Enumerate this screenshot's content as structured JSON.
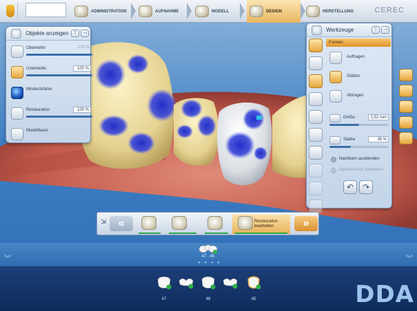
{
  "app": {
    "name": "CEREC",
    "brand": "DDA"
  },
  "workflow_steps": [
    {
      "label": "ADMINISTRATION",
      "active": false,
      "icon": "administration-icon"
    },
    {
      "label": "AUFNAHME",
      "active": false,
      "icon": "acquisition-icon"
    },
    {
      "label": "MODELL",
      "active": false,
      "icon": "model-icon"
    },
    {
      "label": "DESIGN",
      "active": true,
      "icon": "design-icon"
    },
    {
      "label": "HERSTELLUNG",
      "active": false,
      "icon": "manufacturing-icon"
    }
  ],
  "objekte_panel": {
    "title": "Objekte anzeigen",
    "btn_pin": "⊤",
    "btn_collapse": "⊣",
    "rows": [
      {
        "label": "Oberkiefer",
        "value": "100 %",
        "enabled": false,
        "level": 1.0
      },
      {
        "label": "Unterkiefer",
        "value": "100 %",
        "enabled": true,
        "level": 1.0
      },
      {
        "label": "Mindeststärke",
        "value": "",
        "enabled": true
      },
      {
        "label": "Restauration",
        "value": "100 %",
        "enabled": true,
        "level": 1.0
      },
      {
        "label": "Modellbasis",
        "value": "",
        "enabled": true
      }
    ]
  },
  "werkzeuge_panel": {
    "title": "Werkzeuge",
    "btn_pin": "⊤",
    "btn_collapse": "⊣",
    "section": "Formen",
    "tools": [
      {
        "label": "Auftragen",
        "active": false
      },
      {
        "label": "Glätten",
        "active": true
      },
      {
        "label": "Abtragen",
        "active": false
      }
    ],
    "params": [
      {
        "label": "Größe",
        "value": "2,52 mm",
        "level": 0.5
      },
      {
        "label": "Stärke",
        "value": "36 %",
        "level": 0.36
      }
    ],
    "checkboxes": [
      {
        "label": "Nachbarn ausblenden",
        "enabled": true
      },
      {
        "label": "Symmetrisch anwenden",
        "enabled": false
      }
    ],
    "undo": "↶",
    "redo": "↷"
  },
  "phases": {
    "pin": "⇲",
    "prev": "«",
    "next": "»",
    "items": [
      {
        "label": "",
        "active": false
      },
      {
        "label": "",
        "active": false
      },
      {
        "label": "",
        "active": false
      },
      {
        "label": "Restauration bearbeiten",
        "active": true
      }
    ]
  },
  "arch": {
    "label": "47 - 45",
    "pager": "● ● ● ●"
  },
  "carets": {
    "left": "︾",
    "right": "︾"
  },
  "teeth": [
    {
      "number": "47"
    },
    {
      "number": ""
    },
    {
      "number": "46"
    },
    {
      "number": ""
    },
    {
      "number": "45"
    }
  ],
  "colors": {
    "accent": "#e8a43c",
    "panel": "#d3e0ef",
    "highlight": "#1d3fd0",
    "bottom": "#143466"
  }
}
